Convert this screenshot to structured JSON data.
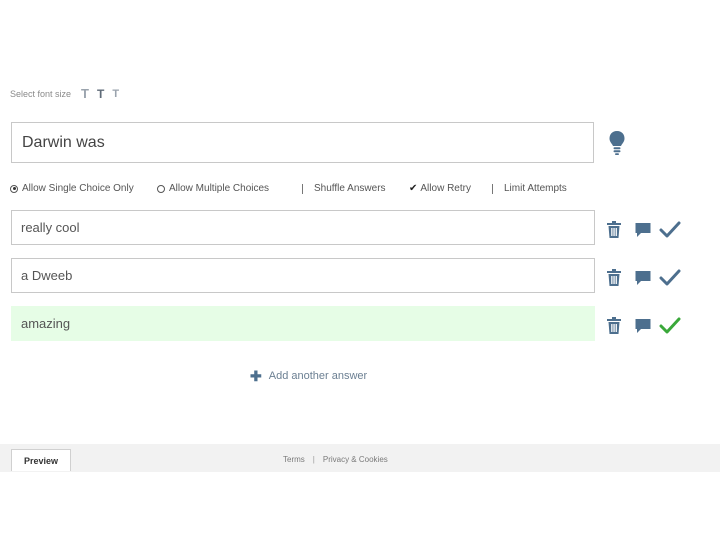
{
  "font_size": {
    "label": "Select font size",
    "options": [
      "T",
      "T",
      "T"
    ]
  },
  "question": {
    "text": "Darwin was",
    "hint_icon": "lightbulb-icon"
  },
  "options": {
    "single_choice": "Allow Single Choice Only",
    "multiple_choice": "Allow Multiple Choices",
    "shuffle": "Shuffle Answers",
    "retry": "Allow Retry",
    "limit_attempts": "Limit Attempts",
    "selected_mode": "single_choice",
    "retry_checked": true
  },
  "answers": [
    {
      "text": "really cool",
      "correct": false
    },
    {
      "text": "a Dweeb",
      "correct": false
    },
    {
      "text": "amazing",
      "correct": true
    }
  ],
  "add_answer_label": "Add another answer",
  "footer": {
    "preview_label": "Preview",
    "terms_label": "Terms",
    "separator": "|",
    "privacy_label": "Privacy & Cookies"
  },
  "colors": {
    "icon_blue": "#4d6f8e",
    "correct_green": "#3aa83a",
    "correct_bg": "#e6fde6",
    "footer_bg": "#f2f2f2"
  }
}
